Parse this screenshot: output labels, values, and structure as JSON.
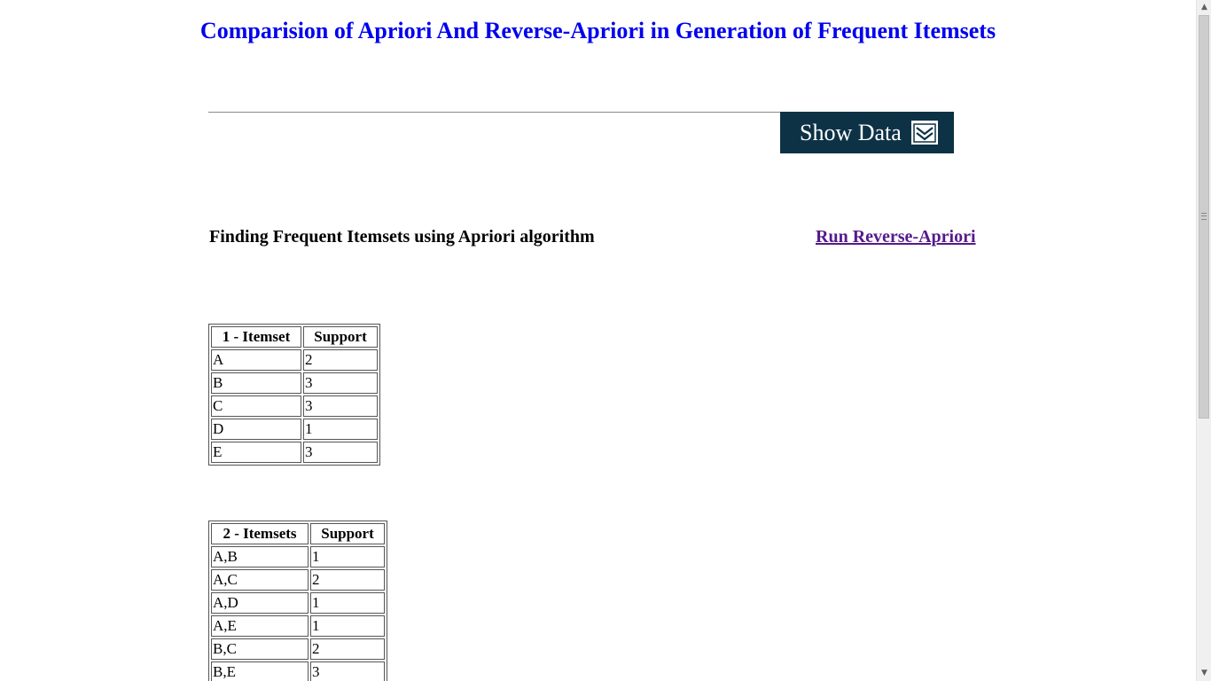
{
  "page": {
    "title": "Comparision of Apriori And Reverse-Apriori in Generation of Frequent Itemsets"
  },
  "show_data_button": {
    "label": "Show Data",
    "icon": "double-chevron-down-icon",
    "background": "#0d3246"
  },
  "section": {
    "heading": "Finding Frequent Itemsets using Apriori algorithm",
    "run_link": "Run Reverse-Apriori"
  },
  "colors": {
    "title": "#0000ee",
    "visited_link": "#551a8b"
  },
  "table1": {
    "headers": [
      "1 - Itemset",
      "Support"
    ],
    "rows": [
      [
        "A",
        "2"
      ],
      [
        "B",
        "3"
      ],
      [
        "C",
        "3"
      ],
      [
        "D",
        "1"
      ],
      [
        "E",
        "3"
      ]
    ]
  },
  "table2": {
    "headers": [
      "2 - Itemsets",
      "Support"
    ],
    "rows": [
      [
        "A,B",
        "1"
      ],
      [
        "A,C",
        "2"
      ],
      [
        "A,D",
        "1"
      ],
      [
        "A,E",
        "1"
      ],
      [
        "B,C",
        "2"
      ],
      [
        "B,E",
        "3"
      ]
    ]
  }
}
